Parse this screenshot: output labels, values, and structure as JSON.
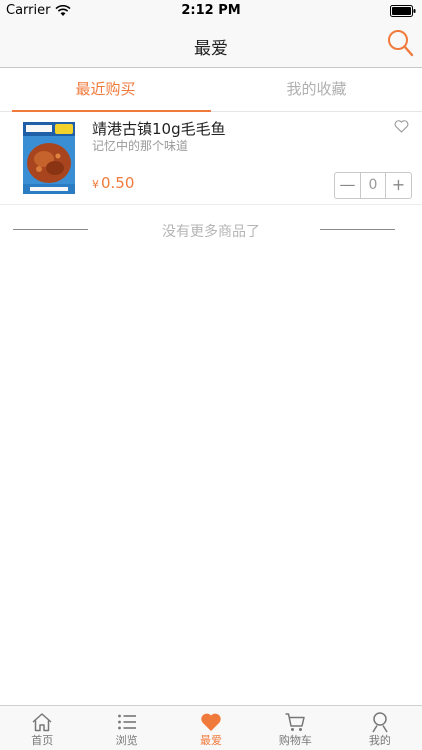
{
  "status_bar": {
    "carrier": "Carrier",
    "time": "2:12 PM"
  },
  "nav": {
    "title": "最爱"
  },
  "tabs": [
    {
      "label": "最近购买",
      "active": true
    },
    {
      "label": "我的收藏",
      "active": false
    }
  ],
  "product": {
    "name": "靖港古镇10g毛毛鱼",
    "description": "记忆中的那个味道",
    "currency": "¥",
    "price": "0.50",
    "quantity": "0",
    "minus_symbol": "—",
    "plus_symbol": "+"
  },
  "empty_message": "没有更多商品了",
  "tab_bar": [
    {
      "label": "首页",
      "icon": "home-icon",
      "active": false
    },
    {
      "label": "浏览",
      "icon": "list-icon",
      "active": false
    },
    {
      "label": "最爱",
      "icon": "heart-icon",
      "active": true
    },
    {
      "label": "购物车",
      "icon": "cart-icon",
      "active": false
    },
    {
      "label": "我的",
      "icon": "user-icon",
      "active": false
    }
  ],
  "colors": {
    "accent": "#f07a3c",
    "inactive": "#777777"
  }
}
